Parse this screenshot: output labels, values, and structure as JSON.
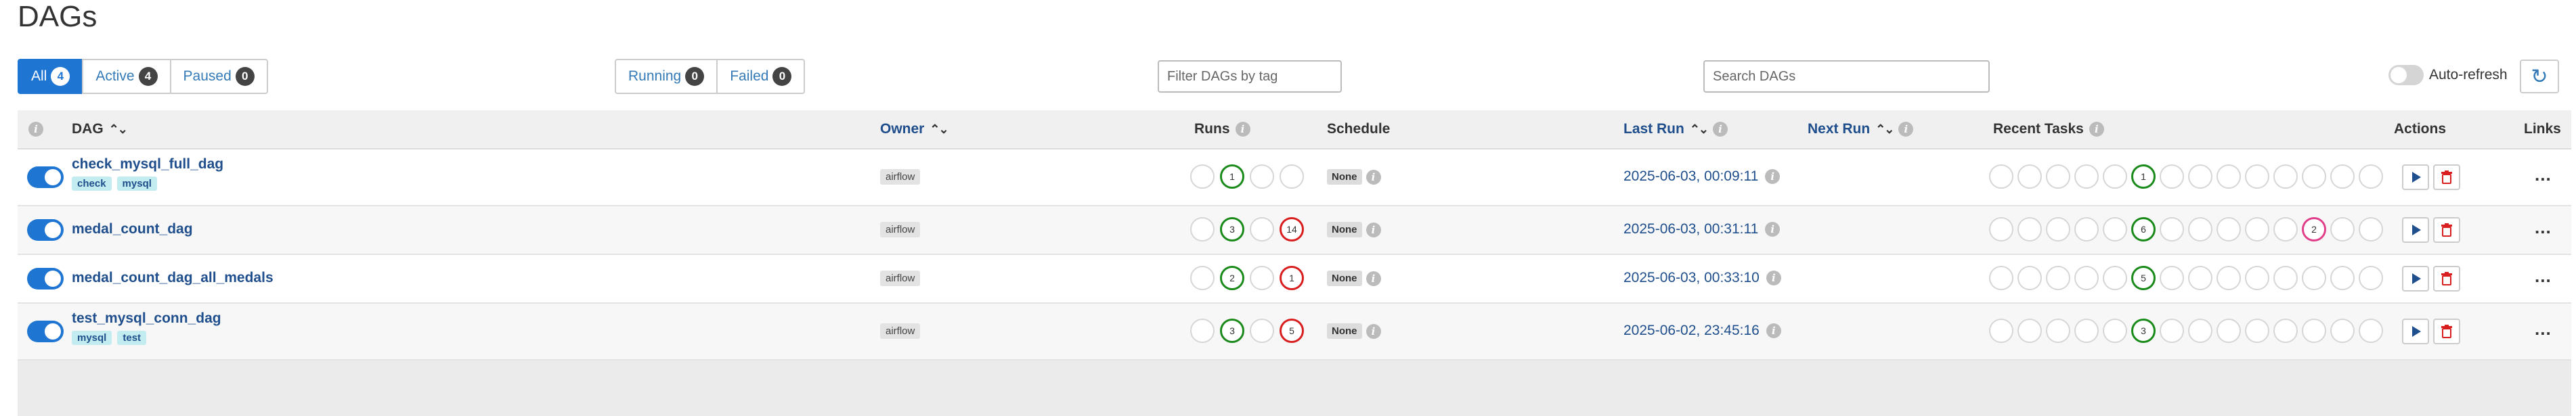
{
  "page_title": "DAGs",
  "filters": {
    "status": [
      {
        "label": "All",
        "count": "4"
      },
      {
        "label": "Active",
        "count": "4"
      },
      {
        "label": "Paused",
        "count": "0"
      }
    ],
    "run_state": [
      {
        "label": "Running",
        "count": "0"
      },
      {
        "label": "Failed",
        "count": "0"
      }
    ],
    "tag_placeholder": "Filter DAGs by tag",
    "search_placeholder": "Search DAGs",
    "auto_refresh_label": "Auto-refresh"
  },
  "table": {
    "headers": {
      "dag": "DAG",
      "owner": "Owner",
      "runs": "Runs",
      "schedule": "Schedule",
      "last_run": "Last Run",
      "next_run": "Next Run",
      "recent_tasks": "Recent Tasks",
      "actions": "Actions",
      "links": "Links"
    },
    "rows": [
      {
        "dag_id": "check_mysql_full_dag",
        "tags": [
          "check",
          "mysql"
        ],
        "owner": "airflow",
        "runs": [
          "",
          "1",
          "",
          ""
        ],
        "schedule": "None",
        "last_run": "2025-06-03, 00:09:11",
        "recent_tasks": [
          "",
          "",
          "",
          "",
          "",
          "1",
          "",
          "",
          "",
          "",
          "",
          "",
          "",
          ""
        ],
        "links": "..."
      },
      {
        "dag_id": "medal_count_dag",
        "tags": [],
        "owner": "airflow",
        "runs": [
          "",
          "3",
          "",
          "14"
        ],
        "schedule": "None",
        "last_run": "2025-06-03, 00:31:11",
        "recent_tasks": [
          "",
          "",
          "",
          "",
          "",
          "6",
          "",
          "",
          "",
          "",
          "",
          "2",
          "",
          ""
        ],
        "links": "..."
      },
      {
        "dag_id": "medal_count_dag_all_medals",
        "tags": [],
        "owner": "airflow",
        "runs": [
          "",
          "2",
          "",
          "1"
        ],
        "schedule": "None",
        "last_run": "2025-06-03, 00:33:10",
        "recent_tasks": [
          "",
          "",
          "",
          "",
          "",
          "5",
          "",
          "",
          "",
          "",
          "",
          "",
          "",
          ""
        ],
        "links": "..."
      },
      {
        "dag_id": "test_mysql_conn_dag",
        "tags": [
          "mysql",
          "test"
        ],
        "owner": "airflow",
        "runs": [
          "",
          "3",
          "",
          "5"
        ],
        "schedule": "None",
        "last_run": "2025-06-02, 23:45:16",
        "recent_tasks": [
          "",
          "",
          "",
          "",
          "",
          "3",
          "",
          "",
          "",
          "",
          "",
          "",
          "",
          ""
        ],
        "links": "..."
      }
    ]
  },
  "colors": {
    "accent": "#1e76d2",
    "success": "#1a8a1a",
    "failed": "#d81e1e",
    "up_for_retry": "#e0408a",
    "link": "#1f4e8c"
  },
  "icons": [
    "info-icon",
    "sort-icon",
    "play-icon",
    "trash-icon",
    "refresh-icon",
    "more-icon"
  ]
}
